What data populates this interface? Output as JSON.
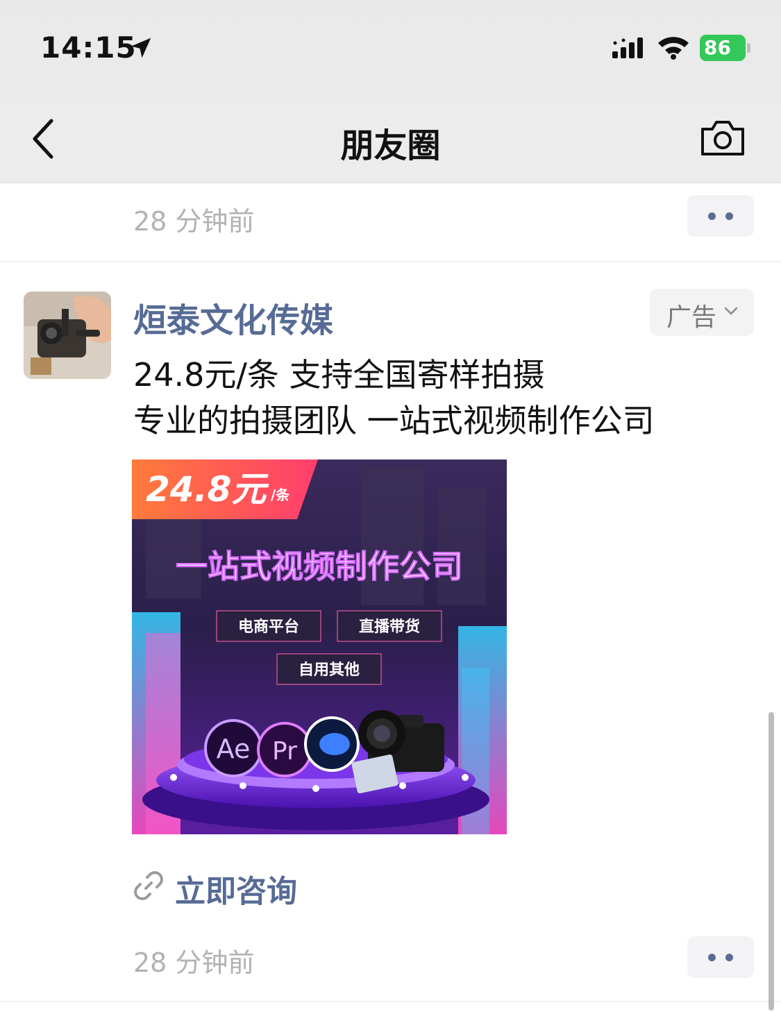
{
  "status_bar": {
    "time": "14:15",
    "battery": "86",
    "icons": [
      "location-arrow-icon",
      "signal-icon",
      "wifi-icon",
      "battery-charging-icon"
    ]
  },
  "nav": {
    "title": "朋友圈",
    "back_icon": "chevron-left-icon",
    "camera_icon": "camera-icon"
  },
  "previous_post": {
    "time": "28 分钟前"
  },
  "ad_post": {
    "author": "烜泰文化传媒",
    "ad_label": "广告",
    "lines": [
      "24.8元/条 支持全国寄样拍摄",
      "专业的拍摄团队 一站式视频制作公司"
    ],
    "image": {
      "price": "24.8元",
      "price_unit": "/条",
      "headline": "一站式视频制作公司",
      "tags": [
        "电商平台",
        "直播带货",
        "自用其他"
      ],
      "logos": [
        "Ae",
        "Pr"
      ]
    },
    "link_text": "立即咨询",
    "time": "28 分钟前"
  },
  "colors": {
    "link_blue": "#566b95",
    "gray_text": "#b2b2b2",
    "battery_green": "#34c759"
  }
}
